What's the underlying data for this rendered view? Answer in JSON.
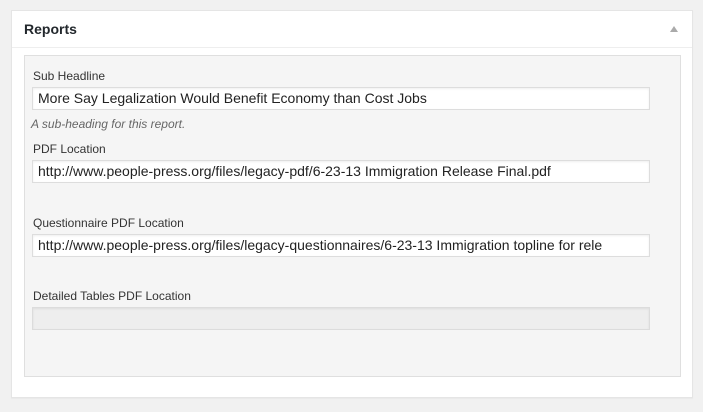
{
  "panel": {
    "title": "Reports"
  },
  "fields": {
    "sub_headline": {
      "label": "Sub Headline",
      "value": "More Say Legalization Would Benefit Economy than Cost Jobs",
      "description": "A sub-heading for this report."
    },
    "pdf_location": {
      "label": "PDF Location",
      "value": "http://www.people-press.org/files/legacy-pdf/6-23-13 Immigration Release Final.pdf"
    },
    "questionnaire_pdf_location": {
      "label": "Questionnaire PDF Location",
      "value": "http://www.people-press.org/files/legacy-questionnaires/6-23-13 Immigration topline for rele"
    },
    "detailed_tables_pdf_location": {
      "label": "Detailed Tables PDF Location",
      "value": ""
    }
  },
  "icons": {
    "toggle": "triangle-up-icon"
  }
}
